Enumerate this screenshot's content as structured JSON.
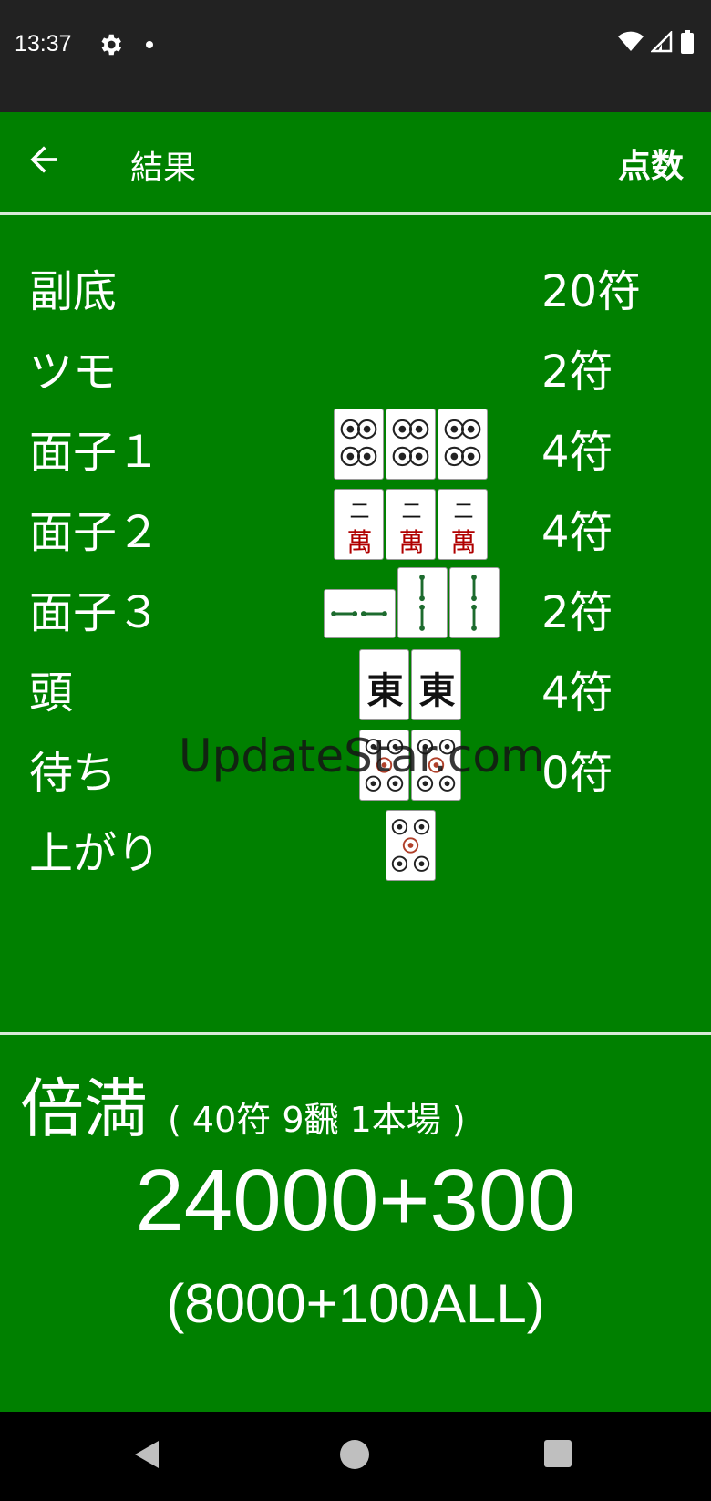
{
  "status_bar": {
    "time": "13:37",
    "icons": [
      "gear-icon",
      "notification-dot-icon",
      "wifi-icon",
      "signal-icon",
      "battery-icon"
    ]
  },
  "app_bar": {
    "back_icon": "arrow-left-icon",
    "title": "結果",
    "action": "点数"
  },
  "rows": [
    {
      "label": "副底",
      "fu": "20符",
      "tiles": []
    },
    {
      "label": "ツモ",
      "fu": "2符",
      "tiles": []
    },
    {
      "label": "面子１",
      "fu": "4符",
      "tiles": [
        "8-pin",
        "8-pin",
        "8-pin"
      ]
    },
    {
      "label": "面子２",
      "fu": "4符",
      "tiles": [
        "2-man",
        "2-man",
        "2-man"
      ]
    },
    {
      "label": "面子３",
      "fu": "2符",
      "tiles": [
        "2-sou-sideways",
        "2-sou",
        "2-sou"
      ]
    },
    {
      "label": "頭",
      "fu": "4符",
      "tiles": [
        "east",
        "east"
      ]
    },
    {
      "label": "待ち",
      "fu": "0符",
      "tiles": [
        "5-pin",
        "5-pin"
      ]
    },
    {
      "label": "上がり",
      "fu": "",
      "tiles": [
        "5-pin"
      ]
    }
  ],
  "tile_text": {
    "man_numeral": "二",
    "man_character": "萬",
    "east": "東"
  },
  "watermark": "UpdateStar.com",
  "result": {
    "yaku_name": "倍満",
    "detail": "( 40符 9飜 1本場 )",
    "total": "24000+300",
    "split": "(8000+100ALL)"
  },
  "colors": {
    "background": "#008000",
    "status_bar": "#222222",
    "nav_bar": "#000000",
    "text": "#ffffff"
  }
}
